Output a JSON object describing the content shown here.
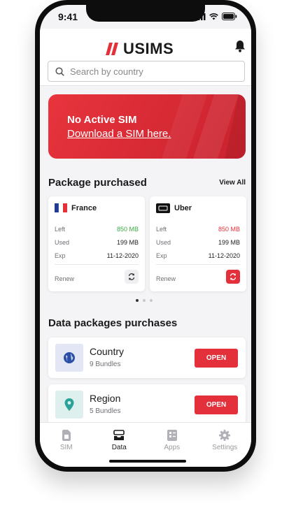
{
  "status_bar": {
    "time": "9:41"
  },
  "header": {
    "brand": "USIMS",
    "search_placeholder": "Search by country"
  },
  "banner": {
    "title": "No Active SIM",
    "link": "Download a SIM here."
  },
  "packages_section": {
    "title": "Package purchased",
    "view_all": "View All",
    "cards": [
      {
        "name": "France",
        "icon": "france-flag-icon",
        "left_label": "Left",
        "left_value": "850 MB",
        "left_color": "#3aaa45",
        "used_label": "Used",
        "used_value": "199 MB",
        "exp_label": "Exp",
        "exp_value": "11-12-2020",
        "renew_label": "Renew"
      },
      {
        "name": "Uber",
        "icon": "uber-logo-icon",
        "left_label": "Left",
        "left_value": "850 MB",
        "left_color": "#e3303b",
        "used_label": "Used",
        "used_value": "199 MB",
        "exp_label": "Exp",
        "exp_value": "11-12-2020",
        "renew_label": "Renew"
      }
    ]
  },
  "data_packages_section": {
    "title": "Data packages purchases",
    "items": [
      {
        "title": "Country",
        "subtitle": "9 Bundles",
        "button": "OPEN",
        "icon": "globe-icon"
      },
      {
        "title": "Region",
        "subtitle": "5 Bundles",
        "button": "OPEN",
        "icon": "location-pin-icon"
      }
    ]
  },
  "tab_bar": {
    "tabs": [
      {
        "label": "SIM",
        "icon": "sim-icon",
        "active": false
      },
      {
        "label": "Data",
        "icon": "data-inbox-icon",
        "active": true
      },
      {
        "label": "Apps",
        "icon": "apps-icon",
        "active": false
      },
      {
        "label": "Settings",
        "icon": "gear-icon",
        "active": false
      }
    ]
  },
  "colors": {
    "accent": "#e3303b",
    "positive": "#3aaa45"
  }
}
